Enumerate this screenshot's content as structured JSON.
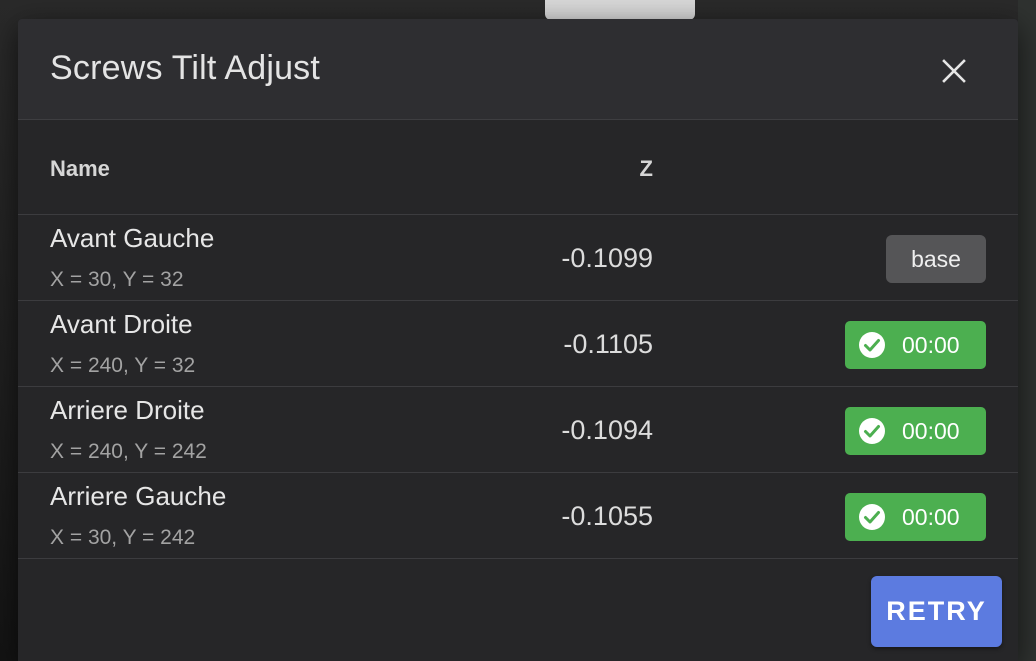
{
  "dialog": {
    "title": "Screws Tilt Adjust",
    "close_icon": "close-icon"
  },
  "table": {
    "headers": {
      "name": "Name",
      "z": "Z"
    },
    "rows": [
      {
        "name": "Avant Gauche",
        "coords": "X = 30, Y = 32",
        "z": "-0.1099",
        "status": "base",
        "status_type": "base"
      },
      {
        "name": "Avant Droite",
        "coords": "X = 240, Y = 32",
        "z": "-0.1105",
        "status": "00:00",
        "status_type": "ok"
      },
      {
        "name": "Arriere Droite",
        "coords": "X = 240, Y = 242",
        "z": "-0.1094",
        "status": "00:00",
        "status_type": "ok"
      },
      {
        "name": "Arriere Gauche",
        "coords": "X = 30, Y = 242",
        "z": "-0.1055",
        "status": "00:00",
        "status_type": "ok"
      }
    ]
  },
  "footer": {
    "retry_label": "RETRY"
  },
  "colors": {
    "dialog_bg": "#262628",
    "header_bg": "#2e2e31",
    "ok_green": "#4caf50",
    "base_gray": "#555557",
    "primary_blue": "#5c7be0"
  },
  "icons": {
    "ok_status": "check-circle-icon"
  }
}
